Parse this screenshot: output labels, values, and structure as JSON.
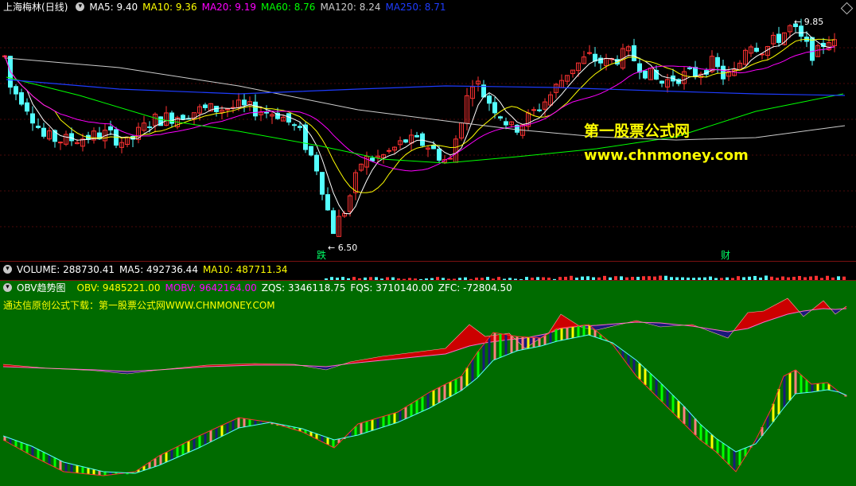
{
  "price_panel": {
    "stock_name": "上海梅林",
    "period": "(日线)",
    "ma_items": [
      {
        "label": "MA5:",
        "value": "9.40",
        "color": "#ffffff"
      },
      {
        "label": "MA10:",
        "value": "9.36",
        "color": "#ffff00"
      },
      {
        "label": "MA20:",
        "value": "9.19",
        "color": "#ff00ff"
      },
      {
        "label": "MA60:",
        "value": "8.76",
        "color": "#00ff00"
      },
      {
        "label": "MA120:",
        "value": "8.24",
        "color": "#cccccc"
      },
      {
        "label": "MA250:",
        "value": "8.71",
        "color": "#1e3cff"
      }
    ],
    "high_label": "9.85",
    "low_label": "6.50",
    "marker_drop": "跌",
    "marker_fin": "财",
    "watermark_cn": "第一股票公式网",
    "watermark_url": "www.chnmoney.com"
  },
  "volume_panel": {
    "items": [
      {
        "label": "VOLUME:",
        "value": "288730.41",
        "color": "#ffffff"
      },
      {
        "label": "MA5:",
        "value": "492736.44",
        "color": "#ffffff"
      },
      {
        "label": "MA10:",
        "value": "487711.34",
        "color": "#ffff00"
      }
    ]
  },
  "obv_panel": {
    "title": "OBV趋势图",
    "items": [
      {
        "label": "OBV:",
        "value": "9485221.00",
        "color": "#ffff00"
      },
      {
        "label": "MOBV:",
        "value": "9642164.00",
        "color": "#ff00ff"
      },
      {
        "label": "ZQS:",
        "value": "3346118.75",
        "color": "#ffffff"
      },
      {
        "label": "FQS:",
        "value": "3710140.00",
        "color": "#ffffff"
      },
      {
        "label": "ZFC:",
        "value": "-72804.50",
        "color": "#ffffff"
      }
    ],
    "subtitle": "通达信原创公式下载：第一股票公式网WWW.CHNMONEY.COM"
  },
  "chart_data": [
    {
      "type": "candlestick",
      "ma_curves": [
        "MA5",
        "MA10",
        "MA20",
        "MA60",
        "MA120",
        "MA250"
      ],
      "high": 9.85,
      "low": 6.5,
      "last_ma": {
        "MA5": 9.4,
        "MA10": 9.36,
        "MA20": 9.19,
        "MA60": 8.76,
        "MA120": 8.24,
        "MA250": 8.71
      }
    },
    {
      "type": "bar",
      "series": [
        {
          "name": "VOLUME",
          "last": 288730.41
        },
        {
          "name": "MA5",
          "last": 492736.44
        },
        {
          "name": "MA10",
          "last": 487711.34
        }
      ]
    },
    {
      "type": "area",
      "series": [
        {
          "name": "OBV",
          "last": 9485221.0
        },
        {
          "name": "MOBV",
          "last": 9642164.0
        },
        {
          "name": "ZQS",
          "last": 3346118.75
        },
        {
          "name": "FQS",
          "last": 3710140.0
        },
        {
          "name": "ZFC",
          "last": -72804.5
        }
      ]
    }
  ],
  "colors": {
    "up": "#ff3232",
    "down": "#54ffff",
    "bg_obv": "#006b00",
    "grid": "#7a1010"
  }
}
